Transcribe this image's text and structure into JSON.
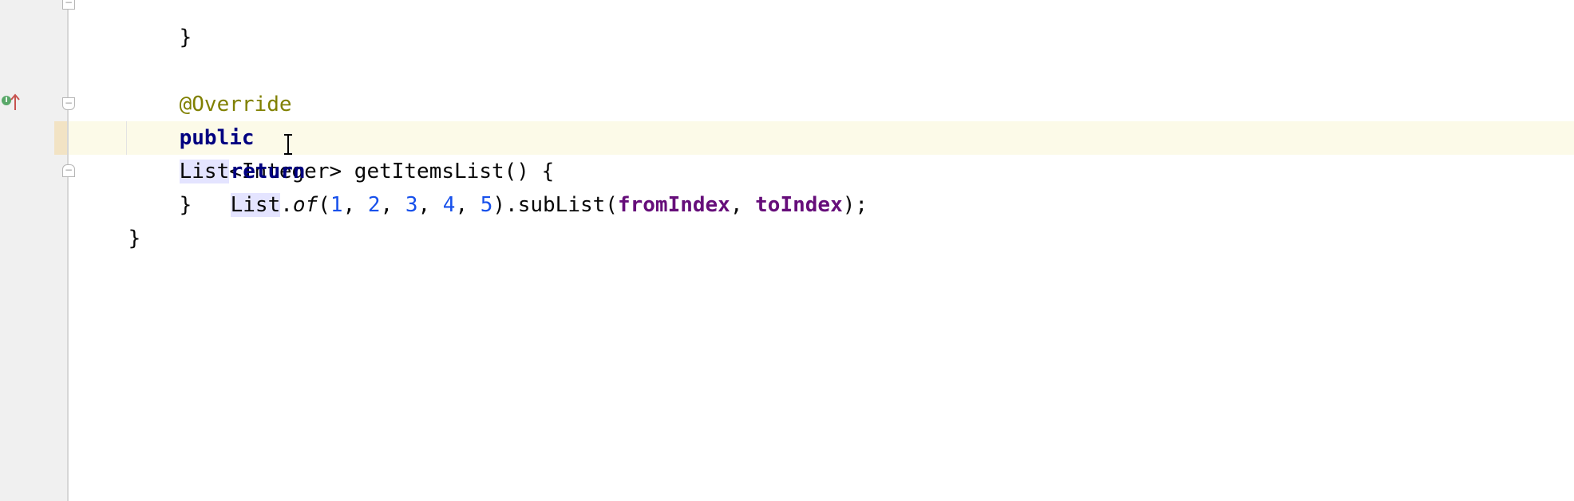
{
  "editor": {
    "gutter": {
      "fold_top_icon": "fold-minus-icon",
      "fold_method_open_icon": "fold-open-icon",
      "fold_method_close_icon": "fold-close-icon",
      "implements_icon": "implements-method-icon",
      "override_arrow_icon": "override-up-arrow-icon"
    },
    "lines": {
      "brace_above": "}",
      "annotation": "@Override",
      "sig_public": "public",
      "sig_type": "List",
      "sig_generic": "<Integer>",
      "sig_rest": " getItemsList() {",
      "ret_keyword": "return",
      "ret_type_prefix": "L",
      "ret_type_suffix": "ist",
      "ret_dot": ".",
      "ret_method": "of",
      "ret_open": "(",
      "n1": "1",
      "n2": "2",
      "n3": "3",
      "n4": "4",
      "n5": "5",
      "comma": ", ",
      "ret_sublist": ").subList(",
      "p1": "fromIndex",
      "p2": "toIndex",
      "ret_end": ");",
      "method_close": "}",
      "class_close": "}"
    },
    "colors": {
      "keyword": "#000080",
      "annotation": "#808000",
      "number": "#1750eb",
      "parameter": "#660e7a",
      "caret_line": "#fcfae8",
      "usage_highlight": "#e4e4ff"
    }
  }
}
